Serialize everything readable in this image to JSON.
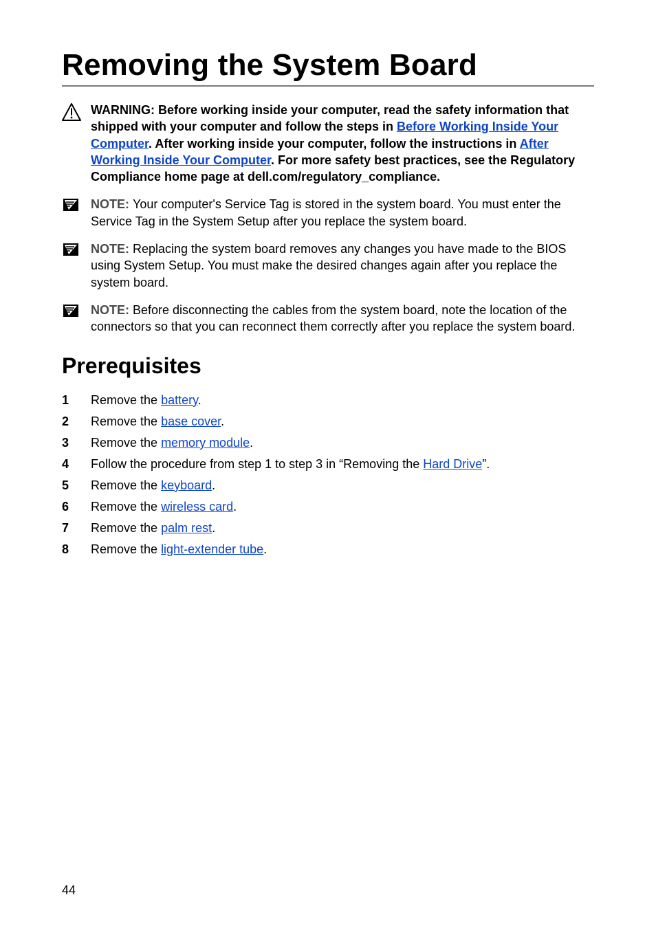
{
  "title": "Removing the System Board",
  "admon": {
    "warning": {
      "pre1": "WARNING: Before working inside your computer, read the safety information that shipped with your computer and follow the steps in ",
      "link1": "Before Working Inside Your Computer",
      "mid1": ". After working inside your computer, follow the instructions in ",
      "link2": "After Working Inside Your Computer",
      "post": ". For more safety best practices, see the Regulatory Compliance home page at dell.com/regulatory_compliance."
    },
    "note1": {
      "label": "NOTE: ",
      "text": "Your computer's Service Tag is stored in the system board. You must enter the Service Tag in the System Setup after you replace the system board."
    },
    "note2": {
      "label": "NOTE: ",
      "text": "Replacing the system board removes any changes you have made to the BIOS using System Setup. You must make the desired changes again after you replace the system board."
    },
    "note3": {
      "label": "NOTE: ",
      "text": "Before disconnecting the cables from the system board, note the location of the connectors so that you can reconnect them correctly after you replace the system board."
    }
  },
  "prereq": {
    "heading": "Prerequisites",
    "steps": {
      "s1": {
        "pre": "Remove the ",
        "link": "battery",
        "post": "."
      },
      "s2": {
        "pre": "Remove the ",
        "link": "base cover",
        "post": "."
      },
      "s3": {
        "pre": "Remove the ",
        "link": "memory module",
        "post": "."
      },
      "s4": {
        "pre": "Follow the procedure from step 1 to step 3 in “Removing the ",
        "link": "Hard Drive",
        "post": "”."
      },
      "s5": {
        "pre": "Remove the ",
        "link": "keyboard",
        "post": "."
      },
      "s6": {
        "pre": "Remove the ",
        "link": "wireless card",
        "post": "."
      },
      "s7": {
        "pre": "Remove the ",
        "link": "palm rest",
        "post": "."
      },
      "s8": {
        "pre": "Remove the ",
        "link": "light-extender tube",
        "post": "."
      }
    }
  },
  "page_number": "44"
}
